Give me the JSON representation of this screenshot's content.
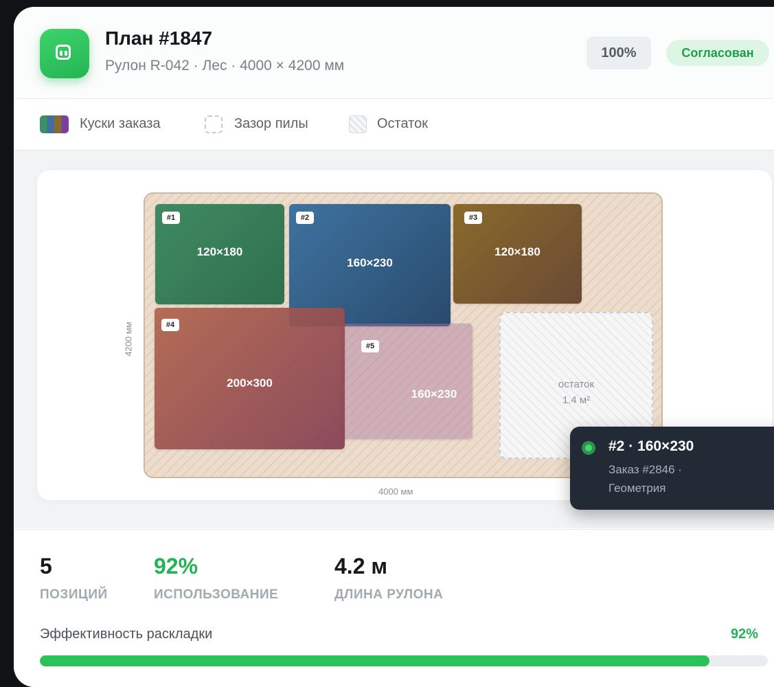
{
  "header": {
    "title": "План #1847",
    "subtitle": "Рулон R-042 · Лес · 4000 × 4200 мм",
    "percent": "100%",
    "status": "Согласован"
  },
  "legend": {
    "pieces": "Куски заказа",
    "kerf": "Зазор пилы",
    "remainder": "Остаток"
  },
  "canvas": {
    "axis_x": "4000 мм",
    "axis_y": "4200 мм",
    "pieces": [
      {
        "tag": "#1",
        "dims": "120×180",
        "color": "#3f8a62"
      },
      {
        "tag": "#2",
        "dims": "160×230",
        "color": "#3e73a0"
      },
      {
        "tag": "#3",
        "dims": "120×180",
        "color": "#8a6a2a"
      },
      {
        "tag": "#4",
        "dims": "200×300",
        "color": "#a45a55"
      },
      {
        "tag": "#5",
        "dims": "160×230",
        "color": "#c49ac0"
      }
    ],
    "remainder": {
      "label": "остаток",
      "area": "1.4 м²"
    }
  },
  "tooltip": {
    "title": "#2 · 160×230",
    "line1": "Заказ #2846 ·",
    "line2": "Геометрия"
  },
  "stats": {
    "positions": {
      "value": "5",
      "label": "ПОЗИЦИЙ"
    },
    "usage": {
      "value": "92%",
      "label": "ИСПОЛЬЗОВАНИЕ"
    },
    "length": {
      "value": "4.2 м",
      "label": "ДЛИНА РУЛОНА"
    }
  },
  "efficiency": {
    "label": "Эффективность раскладки",
    "percent_text": "92%",
    "value": 0.92
  },
  "colors": {
    "accent": "#2cc25a",
    "status_bg": "#dcf6e3",
    "tooltip_bg": "#222a36"
  }
}
